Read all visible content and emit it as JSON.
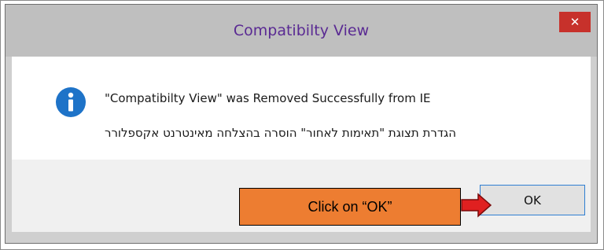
{
  "dialog": {
    "title": "Compatibilty View",
    "close_glyph": "✕",
    "message_en": "\"Compatibilty View\" was Removed Successfully from IE",
    "message_he": "הגדרת תצוגת \"תאימות לאחור\" הוסרה בהצלחה מאינטרנט אקספלורר",
    "info_icon": "info-icon",
    "ok_label": "OK"
  },
  "annotation": {
    "callout_text": "Click on “OK”",
    "callout_color": "#ed7d31",
    "arrow_color": "#e02020",
    "arrow_icon": "right-arrow-icon"
  },
  "colors": {
    "title_text": "#5a2a93",
    "close_button": "#c7312b",
    "info_icon": "#1e73c8",
    "ok_border": "#2f7fd2"
  }
}
